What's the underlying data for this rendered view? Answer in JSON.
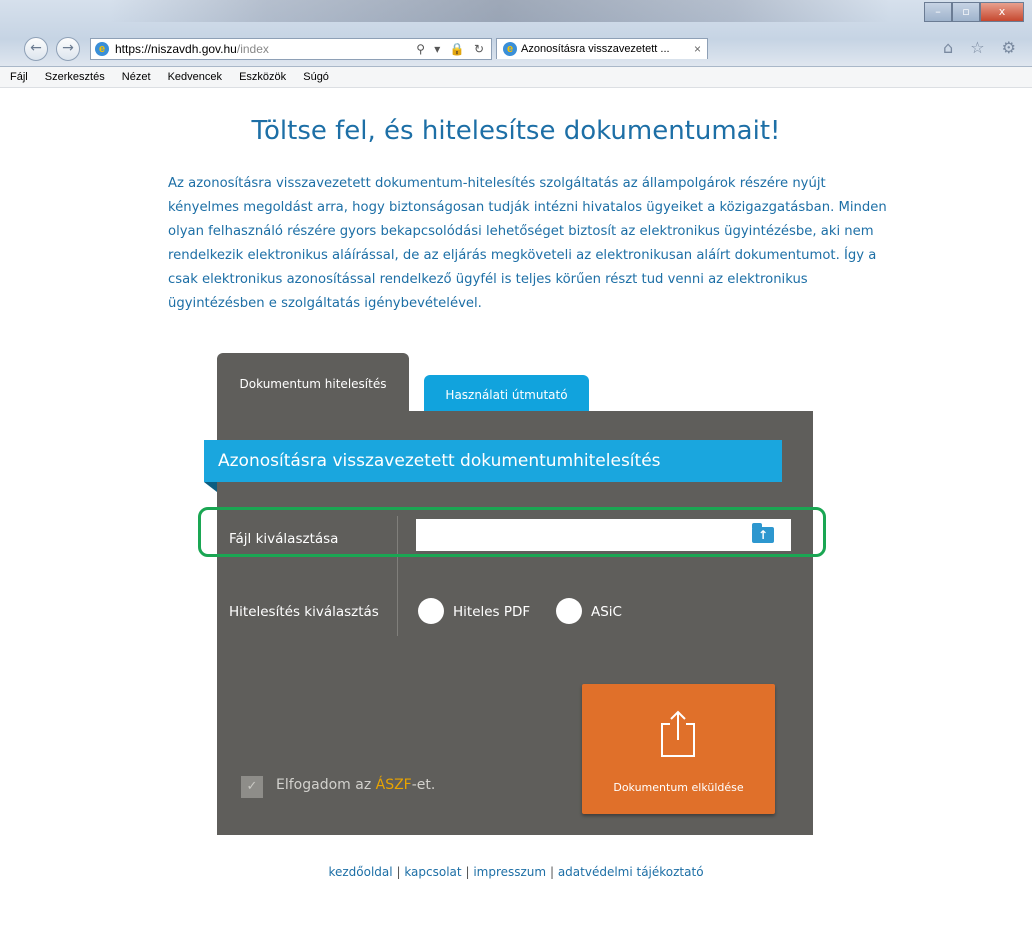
{
  "browser": {
    "url_host": "https://niszavdh.gov.hu",
    "url_path": "/index",
    "addr_controls": "⚲ ▾ 🔒 ↻",
    "tab_title": "Azonosításra visszavezetett ...",
    "tab_close": "×",
    "win_min": "–",
    "win_max": "▫",
    "win_close": "x",
    "toolbar_icons": "⌂ ☆ ⚙",
    "back": "←",
    "forward": "→"
  },
  "menu": [
    "Fájl",
    "Szerkesztés",
    "Nézet",
    "Kedvencek",
    "Eszközök",
    "Súgó"
  ],
  "page": {
    "headline": "Töltse fel, és hitelesítse dokumentumait!",
    "intro": "Az azonosításra visszavezetett dokumentum-hitelesítés szolgáltatás az állampolgárok részére nyújt kényelmes megoldást arra, hogy biztonságosan tudják intézni hivatalos ügyeiket a közigazgatásban. Minden olyan felhasználó részére gyors bekapcsolódási lehetőséget biztosít az elektronikus ügyintézésbe, aki nem rendelkezik elektronikus aláírással, de az eljárás megköveteli az elektronikusan aláírt dokumentumot. Így a csak elektronikus azonosítással rendelkező ügyfél is teljes körűen részt tud venni az elektronikus ügyintézésben e szolgáltatás igénybevételével.",
    "tabs": {
      "active": "Dokumentum hitelesítés",
      "inactive": "Használati útmutató"
    },
    "form": {
      "ribbon_title": "Azonosításra visszavezetett dokumentumhitelesítés",
      "file_label": "Fájl kiválasztása",
      "file_value": "",
      "auth_label": "Hitelesítés kiválasztás",
      "option_pdf": "Hiteles PDF",
      "option_asic": "ASiC",
      "accept_prefix": "Elfogadom az ",
      "accept_link": "ÁSZF",
      "accept_suffix": "-et.",
      "checkbox_mark": "✓",
      "send_label": "Dokumentum elküldése"
    },
    "footer": {
      "home": "kezdőoldal",
      "contact": "kapcsolat",
      "imprint": "impresszum",
      "privacy": "adatvédelmi tájékoztató",
      "separator": "|"
    }
  },
  "colors": {
    "primary_blue": "#1d6fa6",
    "accent_cyan": "#1aa6de",
    "panel_gray": "#5f5e5b",
    "send_orange": "#e0702a",
    "highlight_green": "#1aa653",
    "link_gold": "#e9a400"
  }
}
